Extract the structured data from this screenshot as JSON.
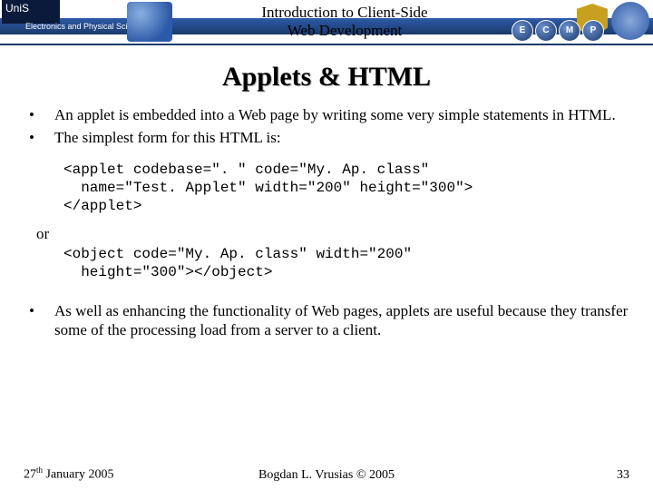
{
  "header": {
    "logo_text": "UniS",
    "logo_subtext": "Electronics and\nPhysical Sciences",
    "course_title_line1": "Introduction to Client-Side",
    "course_title_line2": "Web Development",
    "nav_letters": [
      "E",
      "C",
      "M",
      "P"
    ]
  },
  "slide": {
    "title": "Applets & HTML",
    "bullets": [
      "An applet is embedded into a Web page by writing some very simple statements in HTML.",
      "The simplest form for this HTML is:"
    ],
    "code1_line1": "<applet codebase=\". \" code=\"My. Ap. class\"",
    "code1_line2": "  name=\"Test. Applet\" width=\"200\" height=\"300\">",
    "code1_line3": "</applet>",
    "or_label": "or",
    "code2_line1": "<object code=\"My. Ap. class\" width=\"200\"",
    "code2_line2": "  height=\"300\"></object>",
    "bullet_last": "As well as enhancing the functionality of Web pages, applets are useful because they transfer some of the processing load from a server to a client."
  },
  "footer": {
    "date_day": "27",
    "date_suffix": "th",
    "date_rest": " January 2005",
    "copyright": "Bogdan L. Vrusias © 2005",
    "page": "33"
  }
}
